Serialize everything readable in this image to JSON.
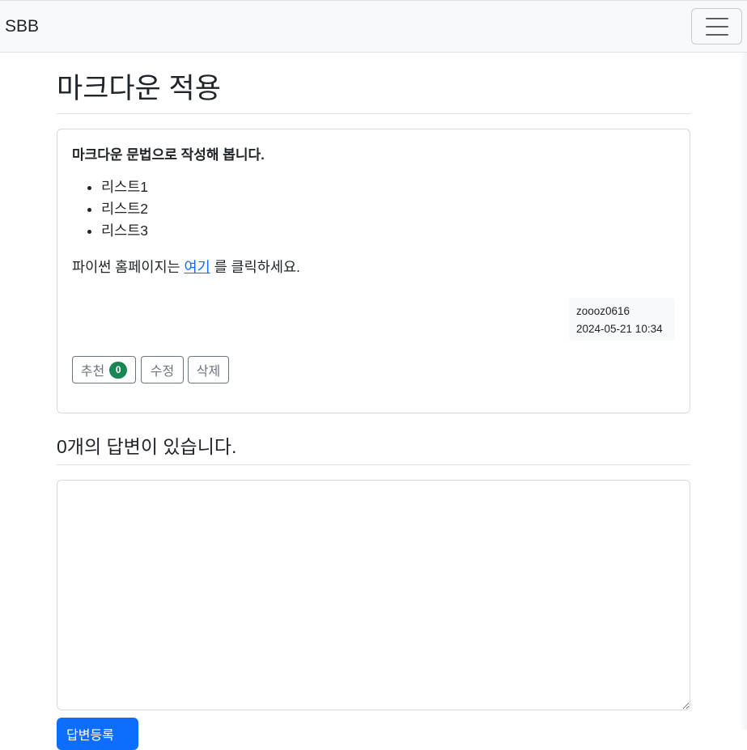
{
  "navbar": {
    "brand": "SBB",
    "toggler_icon": "hamburger-menu-icon"
  },
  "question": {
    "title": "마크다운 적용",
    "content": {
      "strong": "마크다운 문법으로 작성해 봅니다.",
      "list": [
        "리스트1",
        "리스트2",
        "리스트3"
      ],
      "para_before": "파이썬 홈페이지는 ",
      "link_text": "여기",
      "para_after": " 를 클릭하세요."
    },
    "author": "zoooz0616",
    "created": "2024-05-21 10:34",
    "buttons": {
      "recommend": "추천",
      "recommend_count": "0",
      "modify": "수정",
      "delete": "삭제"
    }
  },
  "answers": {
    "count_text": "0개의 답변이 있습니다.",
    "textarea_value": "",
    "submit_label": "답변등록"
  },
  "colors": {
    "primary": "#0d6efd",
    "success": "#198754",
    "secondary": "#6c757d",
    "navbar_bg": "#f8f9fa"
  }
}
